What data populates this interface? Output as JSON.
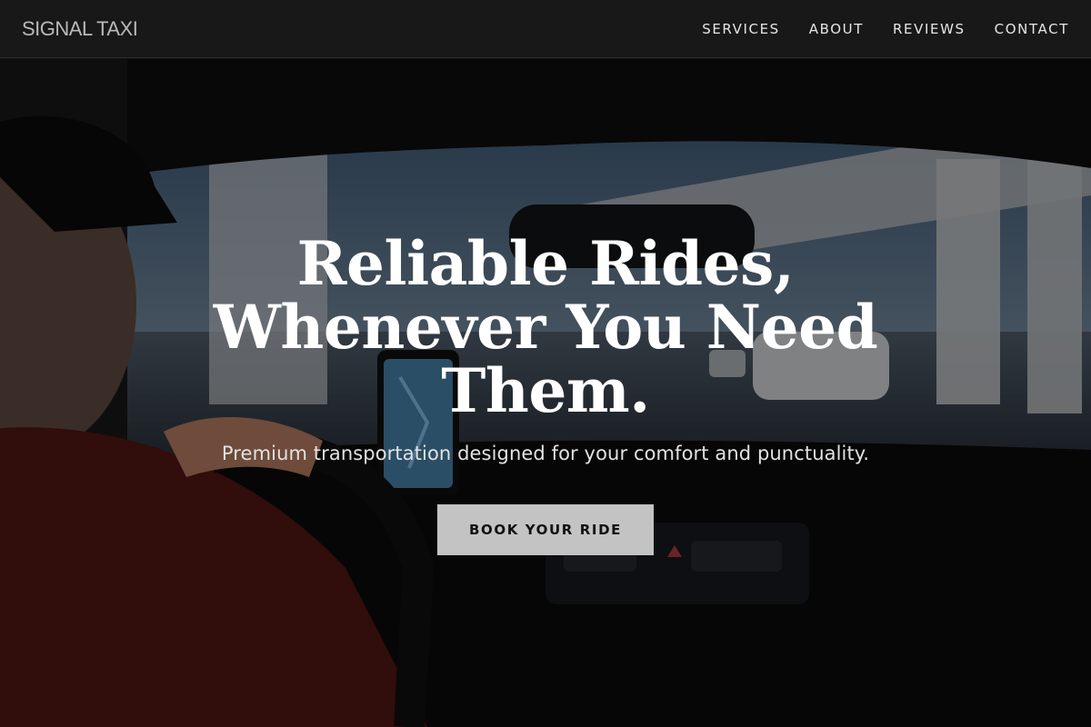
{
  "brand": "SIGNAL TAXI",
  "nav": {
    "items": [
      {
        "label": "SERVICES"
      },
      {
        "label": "ABOUT"
      },
      {
        "label": "REVIEWS"
      },
      {
        "label": "CONTACT"
      }
    ]
  },
  "hero": {
    "title": "Reliable Rides, Whenever You Need Them.",
    "subtitle": "Premium transportation designed for your comfort and punctuality.",
    "cta_label": "BOOK YOUR RIDE",
    "background_image": "taxi-driver-interior-photo"
  },
  "colors": {
    "navbar_bg": "#181818",
    "cta_bg": "#c3c3c3",
    "title_text": "#ffffff"
  }
}
